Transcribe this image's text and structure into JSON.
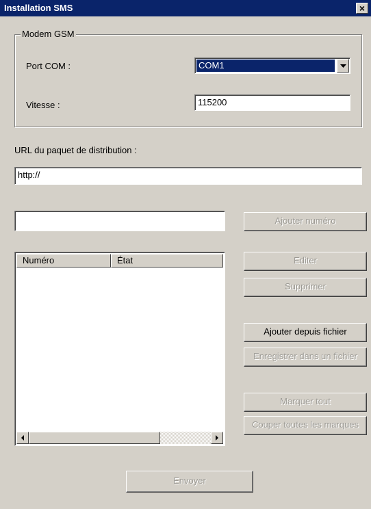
{
  "window": {
    "title": "Installation SMS",
    "close_glyph": "×"
  },
  "modem": {
    "group_title": "Modem GSM",
    "port_label": "Port COM :",
    "port_value": "COM1",
    "speed_label": "Vitesse :",
    "speed_value": "115200"
  },
  "url": {
    "label": "URL du paquet de distribution :",
    "value": "http://"
  },
  "number_input": {
    "value": ""
  },
  "buttons": {
    "add_number": "Ajouter numéro",
    "edit": "Editer",
    "delete": "Supprimer",
    "add_from_file": "Ajouter depuis fichier",
    "save_to_file": "Enregistrer dans un fichier",
    "mark_all": "Marquer tout",
    "unmark_all": "Couper toutes les marques",
    "send": "Envoyer"
  },
  "list": {
    "columns": [
      "Numéro",
      "État"
    ],
    "rows": []
  },
  "icons": {
    "dropdown": "chevron-down-icon",
    "scroll_left": "triangle-left-icon",
    "scroll_right": "triangle-right-icon"
  }
}
